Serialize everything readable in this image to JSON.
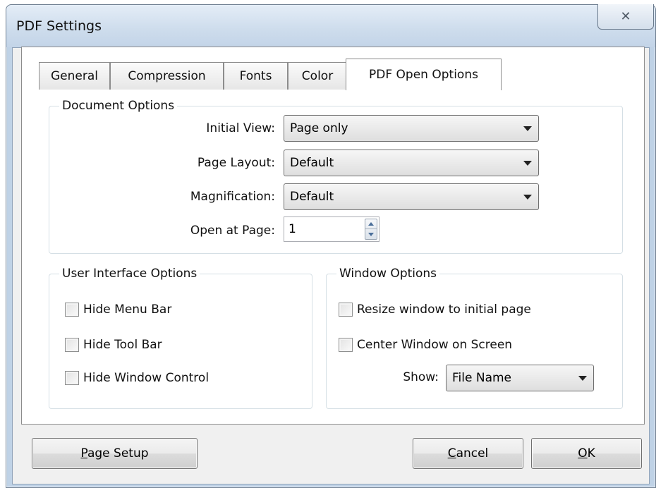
{
  "window": {
    "title": "PDF Settings",
    "close_glyph": "✕"
  },
  "tabs": [
    {
      "label": "General"
    },
    {
      "label": "Compression"
    },
    {
      "label": "Fonts"
    },
    {
      "label": "Color"
    },
    {
      "label": "PDF Open Options",
      "active": true
    }
  ],
  "document_options": {
    "legend": "Document Options",
    "initial_view": {
      "label": "Initial View:",
      "value": "Page only"
    },
    "page_layout": {
      "label": "Page Layout:",
      "value": "Default"
    },
    "magnification": {
      "label": "Magnification:",
      "value": "Default"
    },
    "open_at_page": {
      "label": "Open at Page:",
      "value": "1"
    }
  },
  "ui_options": {
    "legend": "User Interface Options",
    "hide_menu_bar": {
      "label": "Hide Menu Bar",
      "checked": false
    },
    "hide_tool_bar": {
      "label": "Hide Tool Bar",
      "checked": false
    },
    "hide_window_control": {
      "label": "Hide Window Control",
      "checked": false
    }
  },
  "window_options": {
    "legend": "Window Options",
    "resize_window": {
      "label": "Resize window to initial page",
      "checked": false
    },
    "center_window": {
      "label": "Center Window on Screen",
      "checked": false
    },
    "show": {
      "label": "Show:",
      "value": "File Name"
    }
  },
  "buttons": {
    "page_setup": {
      "mnemonic": "P",
      "rest": "age Setup"
    },
    "cancel": {
      "mnemonic": "C",
      "rest": "ancel"
    },
    "ok": {
      "mnemonic": "O",
      "rest": "K"
    }
  }
}
